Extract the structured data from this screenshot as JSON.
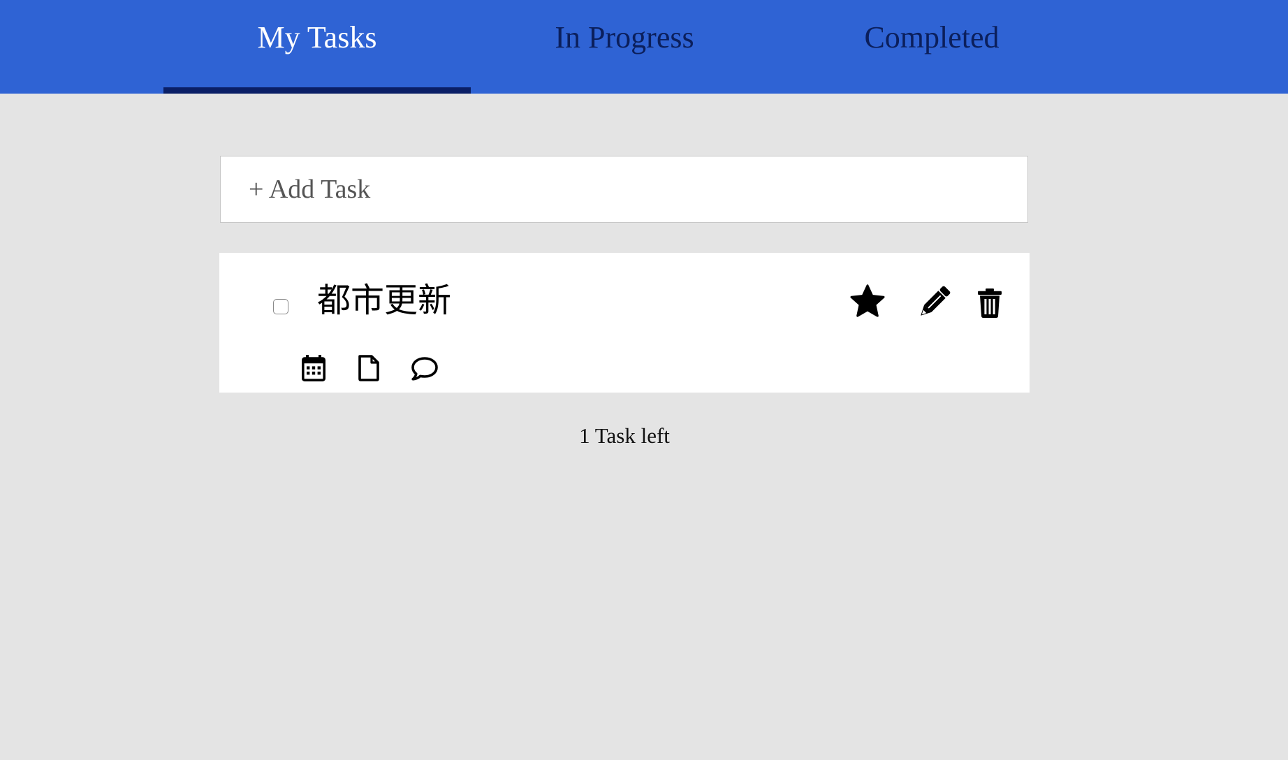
{
  "tabs": [
    {
      "label": "My Tasks",
      "active": true
    },
    {
      "label": "In Progress",
      "active": false
    },
    {
      "label": "Completed",
      "active": false
    }
  ],
  "add_task": {
    "label": "+ Add Task"
  },
  "tasks": [
    {
      "title": "都市更新",
      "completed": false,
      "starred": true,
      "actions": [
        "star-icon",
        "pencil-icon",
        "trash-icon"
      ],
      "meta_icons": [
        "calendar-icon",
        "file-icon",
        "comment-icon"
      ]
    }
  ],
  "footer": {
    "count_text": "1 Task left"
  },
  "colors": {
    "header_bg": "#2f63d4",
    "active_underline": "#0a1f66",
    "inactive_tab_text": "#0b1f5c",
    "page_bg": "#e4e4e4"
  }
}
